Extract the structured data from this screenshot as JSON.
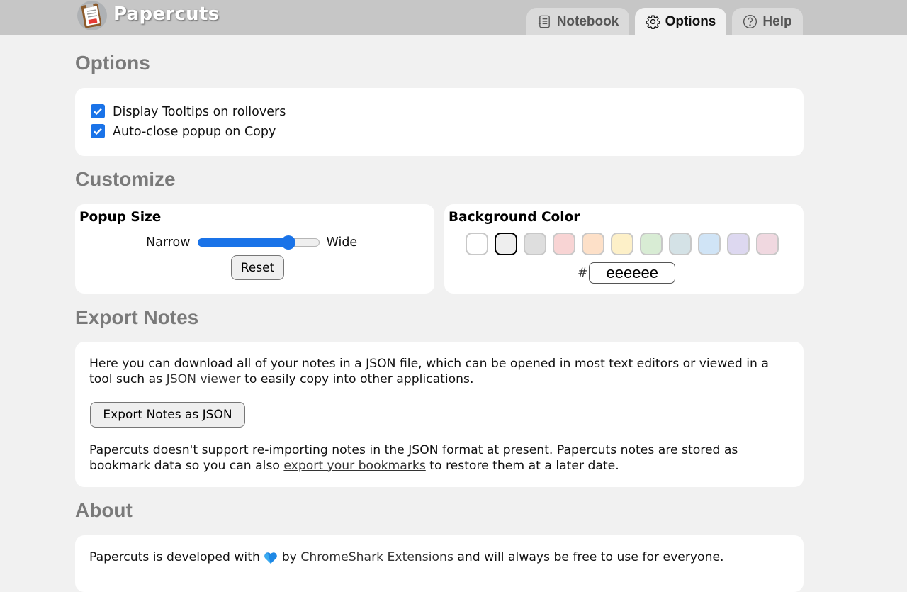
{
  "app": {
    "title": "Papercuts"
  },
  "tabs": [
    {
      "label": "Notebook",
      "icon": "notebook-icon"
    },
    {
      "label": "Options",
      "icon": "gear-icon",
      "active": true
    },
    {
      "label": "Help",
      "icon": "help-icon"
    }
  ],
  "options": {
    "heading": "Options",
    "checkboxes": [
      {
        "label": "Display Tooltips on rollovers",
        "checked": true
      },
      {
        "label": "Auto-close popup on Copy",
        "checked": true
      }
    ]
  },
  "customize": {
    "heading": "Customize",
    "popup_size": {
      "title": "Popup Size",
      "min_label": "Narrow",
      "max_label": "Wide",
      "value_fraction": 0.74,
      "reset_label": "Reset"
    },
    "background_color": {
      "title": "Background Color",
      "swatches": [
        "#ffffff",
        "#eeeeee",
        "#dedede",
        "#f8d4d4",
        "#fde0c8",
        "#fdf0c8",
        "#d8ecd4",
        "#d4e2e6",
        "#d0e4f6",
        "#ddd8f0",
        "#f0d8e0"
      ],
      "selected_index": 1,
      "hash": "#",
      "hex_value": "eeeeee"
    }
  },
  "export": {
    "heading": "Export Notes",
    "para1_before": "Here you can download all of your notes in a JSON file, which can be opened in most text editors or viewed in a tool such as ",
    "para1_link": "JSON viewer",
    "para1_after": " to easily copy into other applications.",
    "button_label": "Export Notes as JSON",
    "para2_before": "Papercuts doesn't support re-importing notes in the JSON format at present. Papercuts notes are stored as bookmark data so you can also ",
    "para2_link": "export your bookmarks",
    "para2_after": " to restore them at a later date."
  },
  "about": {
    "heading": "About",
    "text_before": "Papercuts is developed with ",
    "heart_icon": "heart-icon",
    "text_by": " by ",
    "link": "ChromeShark Extensions",
    "text_after": " and will always be free to use for everyone."
  },
  "colors": {
    "accent": "#1a73e8",
    "topbar": "#c6c6c6",
    "page_bg": "#f1f1f1",
    "heading": "#7a7a7a"
  }
}
